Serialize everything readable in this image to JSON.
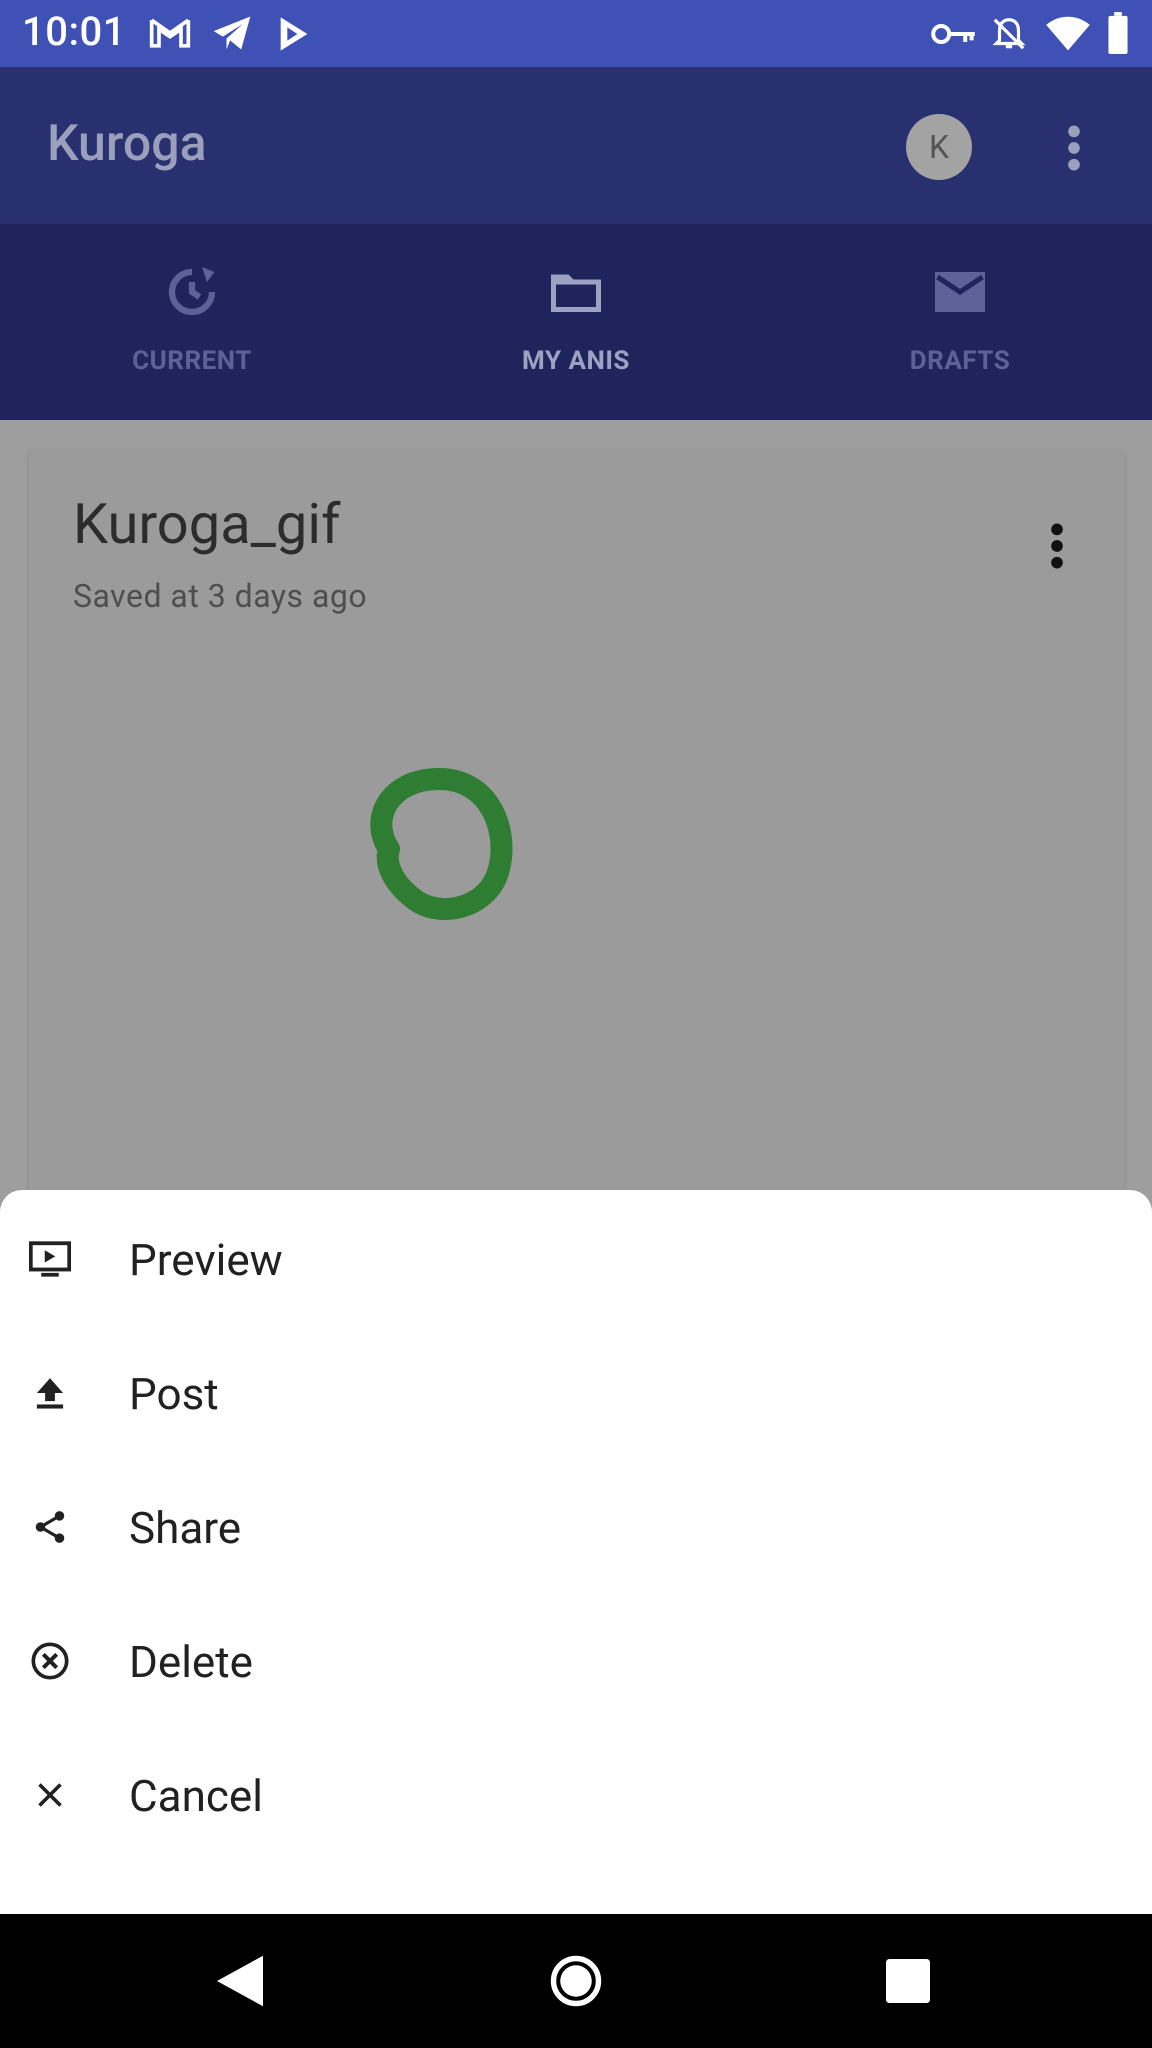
{
  "status_bar": {
    "time": "10:01",
    "left_icons": [
      "gmail-icon",
      "telegram-icon",
      "play-store-icon"
    ],
    "right_icons": [
      "vpn-key-icon",
      "notifications-off-icon",
      "wifi-icon",
      "battery-icon"
    ]
  },
  "app_bar": {
    "title": "Kuroga",
    "avatar_letter": "K"
  },
  "tabs": [
    {
      "label": "CURRENT",
      "icon": "history-icon",
      "active": false
    },
    {
      "label": "MY ANIS",
      "icon": "folder-icon",
      "active": true
    },
    {
      "label": "DRAFTS",
      "icon": "mail-icon",
      "active": false
    }
  ],
  "card": {
    "title": "Kuroga_gif",
    "subtitle": "Saved at 3 days ago"
  },
  "bottom_sheet": {
    "items": [
      {
        "label": "Preview",
        "icon": "preview-icon"
      },
      {
        "label": "Post",
        "icon": "upload-icon"
      },
      {
        "label": "Share",
        "icon": "share-icon"
      },
      {
        "label": "Delete",
        "icon": "delete-circle-icon"
      },
      {
        "label": "Cancel",
        "icon": "close-icon"
      }
    ]
  },
  "colors": {
    "status_bar": "#3f51b5",
    "app_bar_dimmed": "#29306f",
    "tabs_dimmed": "#1f245d",
    "scrim_card": "#9b9b9b",
    "drawing_green": "#2e7d32"
  }
}
